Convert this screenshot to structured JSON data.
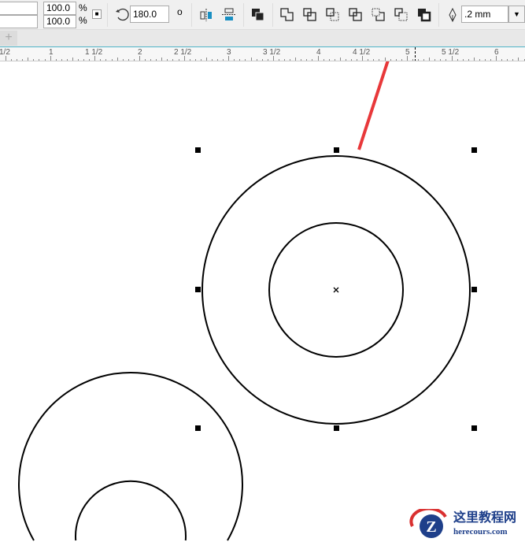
{
  "toolbar": {
    "scale_x": "100.0",
    "scale_y": "100.0",
    "percent": "%",
    "rotation": "180.0",
    "degree": "o",
    "outline_width": ".2 mm"
  },
  "icons": [
    "lock-icon",
    "rotate-icon",
    "mirror-horizontal-icon",
    "mirror-vertical-icon",
    "arrange-icon",
    "weld-icon",
    "trim-icon",
    "intersect-icon",
    "simplify-icon",
    "front-minus-back-icon",
    "back-minus-front-icon",
    "boundary-icon",
    "pen-icon",
    "dropdown-icon",
    "add-page-icon"
  ],
  "tabbar": {
    "add": "+"
  },
  "ruler": {
    "labels": [
      "1/2",
      "1",
      "1 1/2",
      "2",
      "2 1/2",
      "3",
      "3 1/2",
      "4",
      "4 1/2",
      "5",
      "5 1/2",
      "6"
    ]
  },
  "watermark": {
    "title": "这里教程网",
    "url": "herecours.com",
    "logo": "Z"
  },
  "colors": {
    "arrow": "#e8383a",
    "accent": "#1a8fc2"
  }
}
